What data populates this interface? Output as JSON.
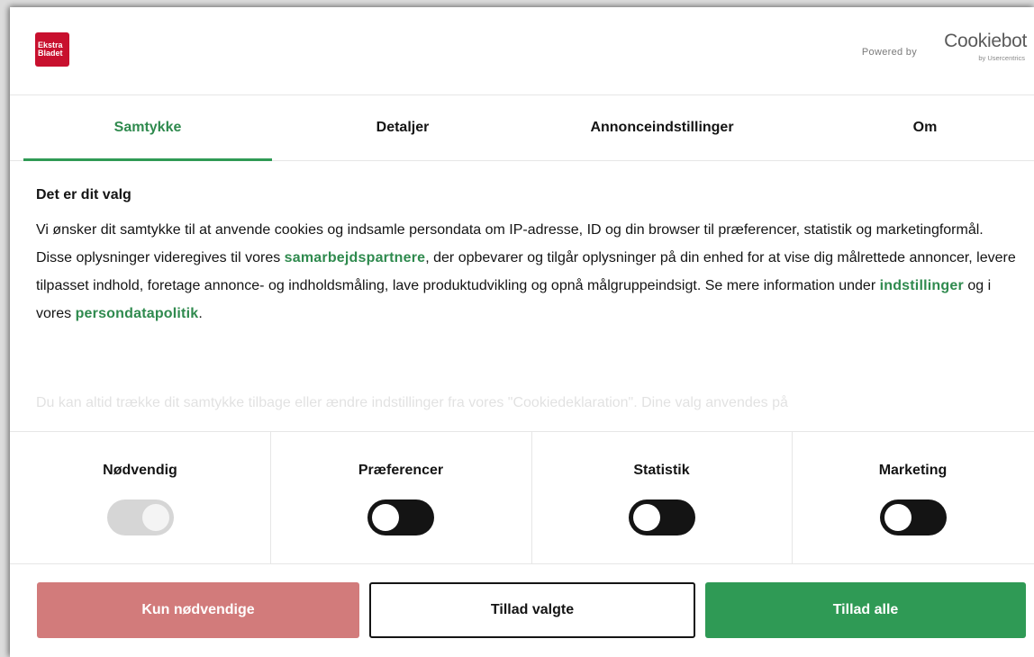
{
  "header": {
    "logo_line1": "Ekstra",
    "logo_line2": "Bladet",
    "powered_by": "Powered by",
    "cookiebot_name": "Cookiebot",
    "cookiebot_sub": "by Usercentrics"
  },
  "tabs": [
    {
      "label": "Samtykke",
      "active": true
    },
    {
      "label": "Detaljer",
      "active": false
    },
    {
      "label": "Annonceindstillinger",
      "active": false
    },
    {
      "label": "Om",
      "active": false
    }
  ],
  "content": {
    "heading": "Det er dit valg",
    "text_1": "Vi ønsker dit samtykke til at anvende cookies og indsamle persondata om IP-adresse, ID og din browser til præferencer, statistik og marketingformål. Disse oplysninger videregives til vores ",
    "link_partners": "samarbejdspartnere",
    "text_2": ", der opbevarer og tilgår oplysninger på din enhed for at vise dig målrettede annoncer, levere tilpasset indhold, foretage annonce- og indholdsmåling, lave produktudvikling og opnå målgruppeindsigt. Se mere information under ",
    "link_settings": "indstillinger",
    "text_3": " og i vores ",
    "link_privacy": "persondatapolitik",
    "text_4": ".",
    "faded_text": "Du kan altid trække dit samtykke tilbage eller ændre indstillinger fra vores \"Cookiedeklaration\". Dine valg anvendes på"
  },
  "categories": [
    {
      "label": "Nødvendig",
      "enabled": true,
      "disabled": true
    },
    {
      "label": "Præferencer",
      "enabled": false,
      "disabled": false
    },
    {
      "label": "Statistik",
      "enabled": false,
      "disabled": false
    },
    {
      "label": "Marketing",
      "enabled": false,
      "disabled": false
    }
  ],
  "buttons": {
    "necessary_only": "Kun nødvendige",
    "allow_selected": "Tillad valgte",
    "allow_all": "Tillad alle"
  },
  "colors": {
    "accent_green": "#2f9a55",
    "link_green": "#2f8a4e",
    "necessary_button": "#d27b7b",
    "brand_red": "#c8102e",
    "toggle_off": "#141414"
  }
}
